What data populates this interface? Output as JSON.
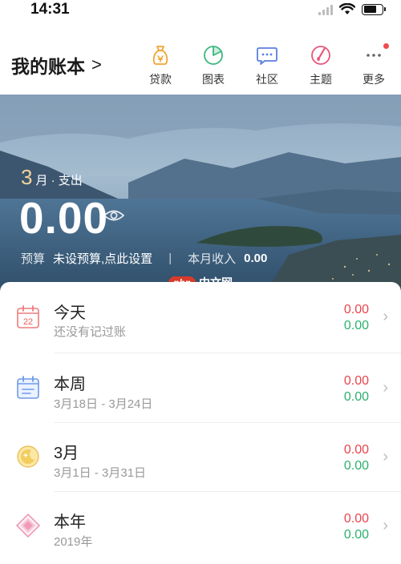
{
  "status_bar": {
    "time": "14:31"
  },
  "header": {
    "book_title": "我的账本",
    "chevron": ">",
    "nav": [
      {
        "label": "贷款",
        "icon": "money-bag-icon"
      },
      {
        "label": "图表",
        "icon": "pie-chart-icon"
      },
      {
        "label": "社区",
        "icon": "chat-bubble-icon"
      },
      {
        "label": "主题",
        "icon": "theme-brush-icon"
      },
      {
        "label": "更多",
        "icon": "more-dots-icon"
      }
    ]
  },
  "summary": {
    "month_number": "3",
    "month_label": "月 · 支出",
    "expense_amount": "0.00",
    "budget_label": "预算",
    "budget_value": "未设预算,点此设置",
    "separator": "|",
    "income_label": "本月收入",
    "income_value": "0.00"
  },
  "watermark": {
    "badge": "php",
    "text": "中文网"
  },
  "periods": [
    {
      "title": "今天",
      "subtitle": "还没有记过账",
      "expense": "0.00",
      "income": "0.00",
      "icon": "calendar-day-icon",
      "day": "22"
    },
    {
      "title": "本周",
      "subtitle": "3月18日 - 3月24日",
      "expense": "0.00",
      "income": "0.00",
      "icon": "calendar-week-icon"
    },
    {
      "title": "3月",
      "subtitle": "3月1日 - 3月31日",
      "expense": "0.00",
      "income": "0.00",
      "icon": "moon-icon"
    },
    {
      "title": "本年",
      "subtitle": "2019年",
      "expense": "0.00",
      "income": "0.00",
      "icon": "diamond-icon"
    }
  ],
  "colors": {
    "expense": "#e8454d",
    "income": "#2bb16d",
    "month_accent": "#f4d49a"
  }
}
